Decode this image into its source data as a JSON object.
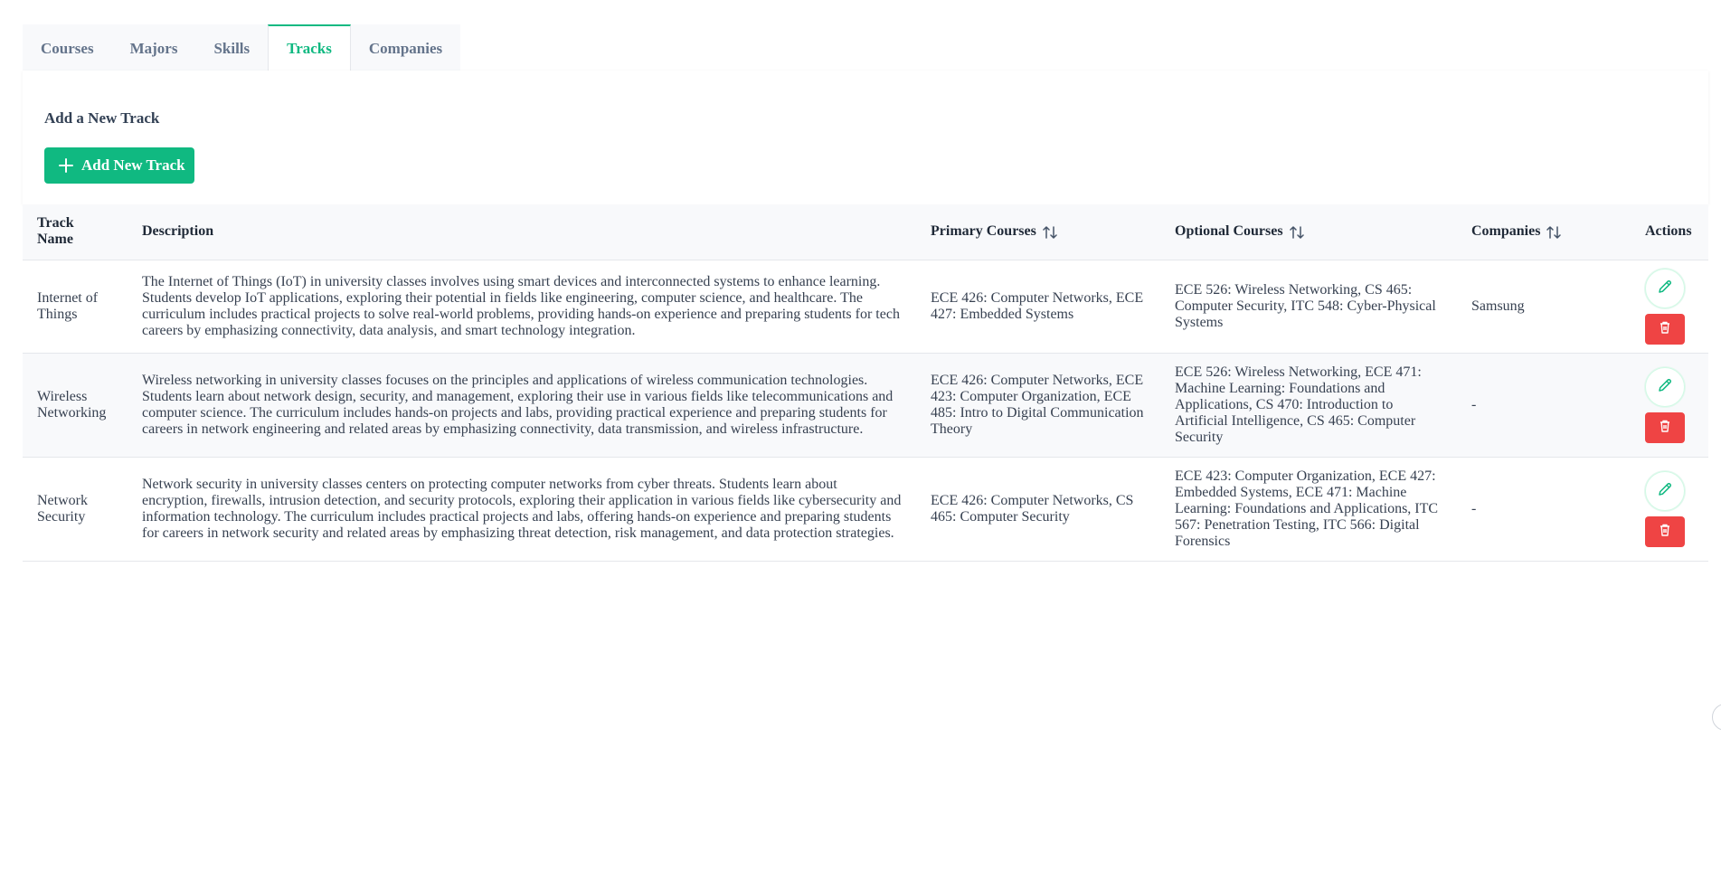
{
  "tabs": [
    {
      "label": "Courses"
    },
    {
      "label": "Majors"
    },
    {
      "label": "Skills"
    },
    {
      "label": "Tracks"
    },
    {
      "label": "Companies"
    }
  ],
  "active_tab": "Tracks",
  "add_section": {
    "title": "Add a New Track",
    "button_label": "Add New Track"
  },
  "table": {
    "headers": {
      "track_name": "Track Name",
      "description": "Description",
      "primary_courses": "Primary Courses",
      "optional_courses": "Optional Courses",
      "companies": "Companies",
      "actions": "Actions"
    },
    "rows": [
      {
        "track_name": "Internet of Things",
        "description": "The Internet of Things (IoT) in university classes involves using smart devices and interconnected systems to enhance learning. Students develop IoT applications, exploring their potential in fields like engineering, computer science, and healthcare. The curriculum includes practical projects to solve real-world problems, providing hands-on experience and preparing students for tech careers by emphasizing connectivity, data analysis, and smart technology integration.",
        "primary_courses": "ECE 426: Computer Networks, ECE 427: Embedded Systems",
        "optional_courses": "ECE 526: Wireless Networking, CS 465: Computer Security, ITC 548: Cyber-Physical Systems",
        "companies": "Samsung"
      },
      {
        "track_name": "Wireless Networking",
        "description": "Wireless networking in university classes focuses on the principles and applications of wireless communication technologies. Students learn about network design, security, and management, exploring their use in various fields like telecommunications and computer science. The curriculum includes hands-on projects and labs, providing practical experience and preparing students for careers in network engineering and related areas by emphasizing connectivity, data transmission, and wireless infrastructure.",
        "primary_courses": "ECE 426: Computer Networks, ECE 423: Computer Organization, ECE 485: Intro to Digital Communication Theory",
        "optional_courses": "ECE 526: Wireless Networking, ECE 471: Machine Learning: Foundations and Applications, CS 470: Introduction to Artificial Intelligence, CS 465: Computer Security",
        "companies": "-"
      },
      {
        "track_name": "Network Security",
        "description": "Network security in university classes centers on protecting computer networks from cyber threats. Students learn about encryption, firewalls, intrusion detection, and security protocols, exploring their application in various fields like cybersecurity and information technology. The curriculum includes practical projects and labs, offering hands-on experience and preparing students for careers in network security and related areas by emphasizing threat detection, risk management, and data protection strategies.",
        "primary_courses": "ECE 426: Computer Networks, CS 465: Computer Security",
        "optional_courses": "ECE 423: Computer Organization, ECE 427: Embedded Systems, ECE 471: Machine Learning: Foundations and Applications, ITC 567: Penetration Testing, ITC 566: Digital Forensics",
        "companies": "-"
      }
    ]
  },
  "colors": {
    "accent": "#10b981",
    "danger": "#ef4444",
    "header_bg": "#f8f9fb"
  },
  "icons": {
    "add": "plus-icon",
    "sort": "sort-arrows-icon",
    "edit": "pencil-icon",
    "delete": "trash-icon"
  }
}
